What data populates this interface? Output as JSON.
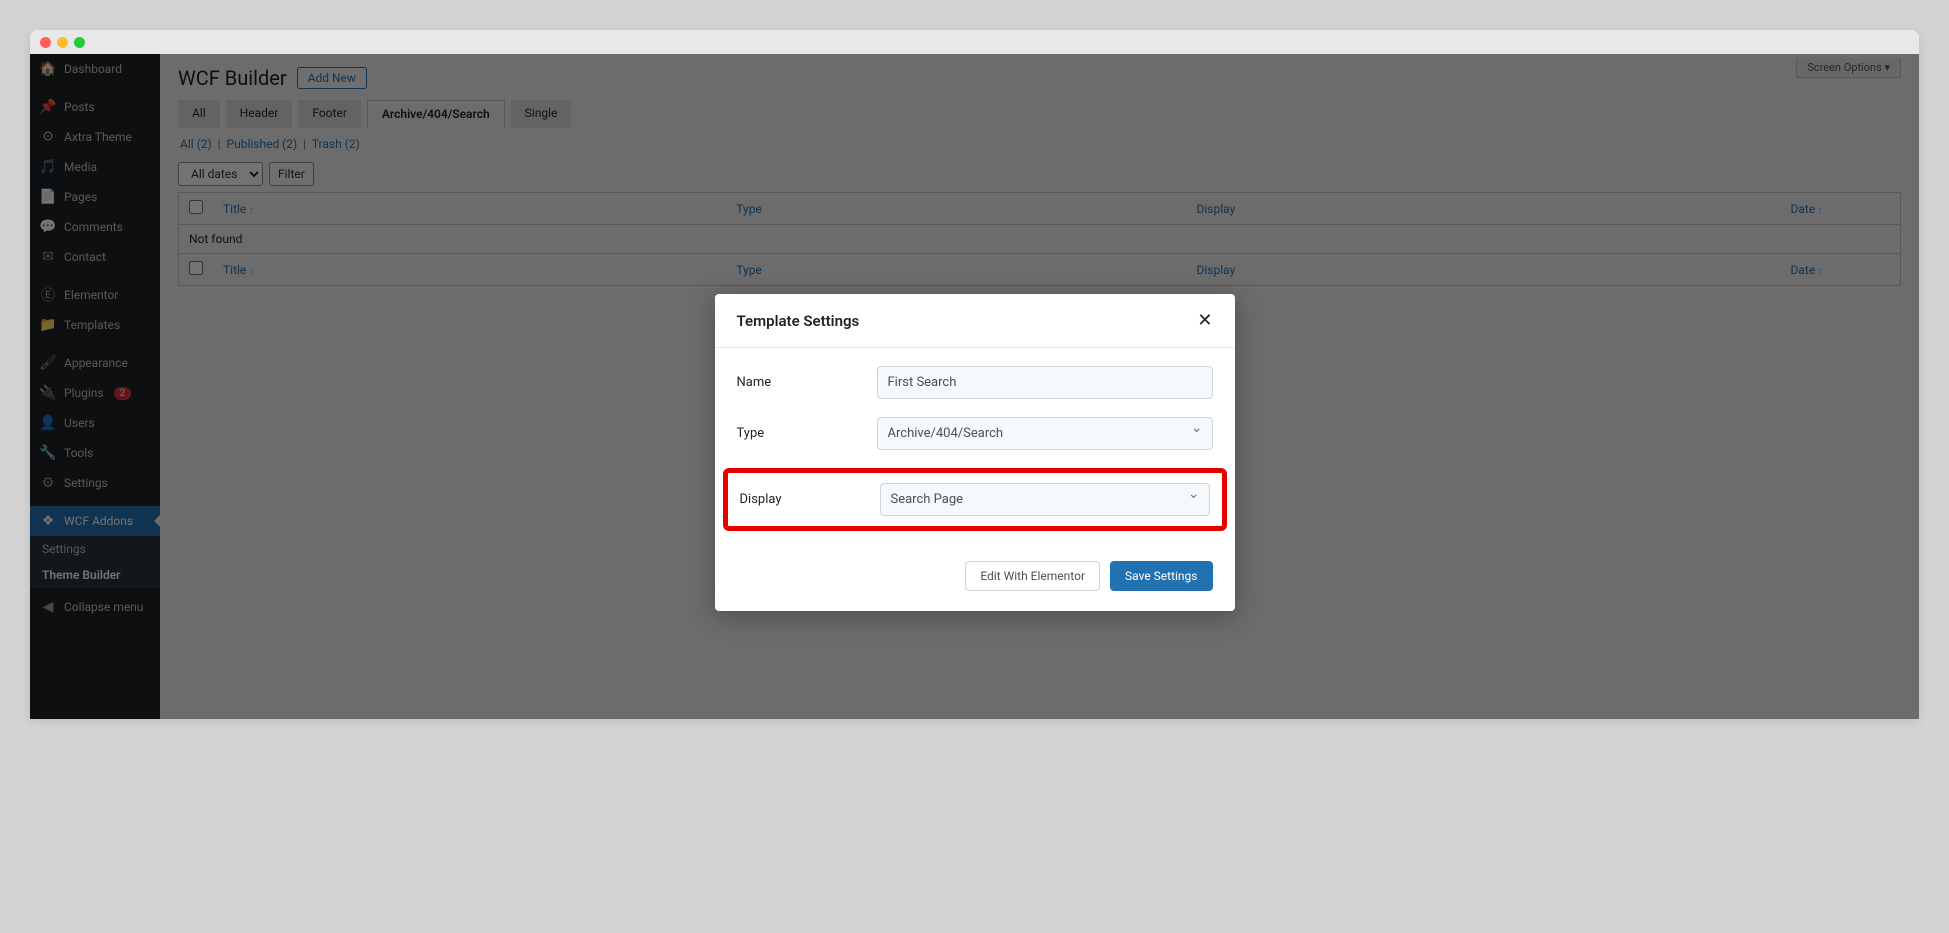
{
  "screenOptions": "Screen Options ▾",
  "sidebar": {
    "items": [
      {
        "label": "Dashboard",
        "icon": "⚙"
      },
      {
        "label": "Posts",
        "icon": "📌"
      },
      {
        "label": "Axtra Theme",
        "icon": "⚙"
      },
      {
        "label": "Media",
        "icon": "🎵"
      },
      {
        "label": "Pages",
        "icon": "📄"
      },
      {
        "label": "Comments",
        "icon": "💬"
      },
      {
        "label": "Contact",
        "icon": "✉"
      },
      {
        "label": "Elementor",
        "icon": "Ⓔ"
      },
      {
        "label": "Templates",
        "icon": "📁"
      },
      {
        "label": "Appearance",
        "icon": "🎨"
      },
      {
        "label": "Plugins",
        "icon": "🔌",
        "badge": "2"
      },
      {
        "label": "Users",
        "icon": "👤"
      },
      {
        "label": "Tools",
        "icon": "🔧"
      },
      {
        "label": "Settings",
        "icon": "⚙"
      },
      {
        "label": "WCF Addons",
        "icon": "❖"
      }
    ],
    "submenu": [
      {
        "label": "Settings"
      },
      {
        "label": "Theme Builder"
      }
    ],
    "collapse": "Collapse menu"
  },
  "page": {
    "title": "WCF Builder",
    "addNew": "Add New",
    "tabs": [
      "All",
      "Header",
      "Footer",
      "Archive/404/Search",
      "Single"
    ],
    "activeTab": 3,
    "status": {
      "all": "All (2)",
      "published": "Published (2)",
      "trash": "Trash (2)"
    },
    "filter": {
      "dates": "All dates",
      "button": "Filter"
    },
    "columns": {
      "title": "Title",
      "type": "Type",
      "display": "Display",
      "date": "Date"
    },
    "notFound": "Not found"
  },
  "modal": {
    "title": "Template Settings",
    "name": {
      "label": "Name",
      "value": "First Search"
    },
    "type": {
      "label": "Type",
      "value": "Archive/404/Search"
    },
    "display": {
      "label": "Display",
      "value": "Search Page"
    },
    "editBtn": "Edit With Elementor",
    "saveBtn": "Save Settings"
  }
}
